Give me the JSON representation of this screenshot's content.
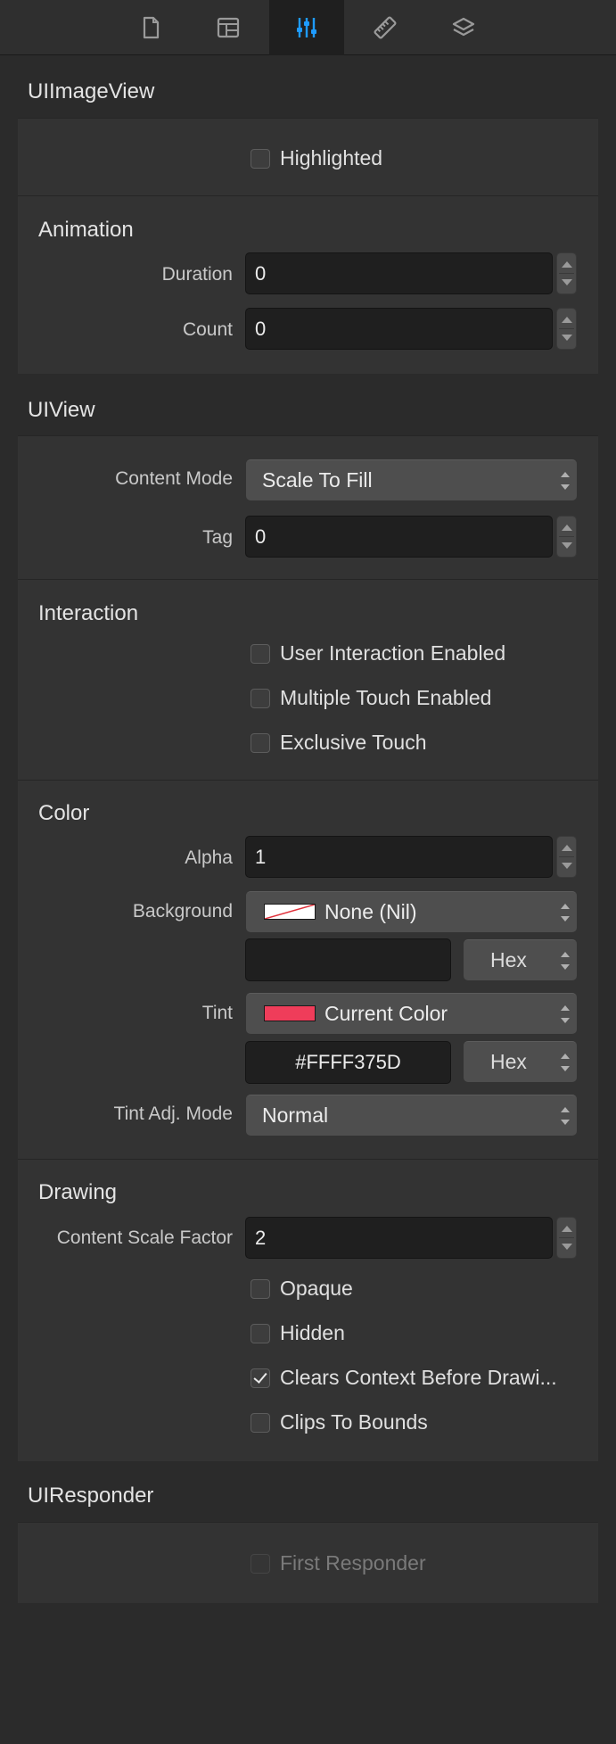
{
  "tabs": [
    {
      "icon": "file-icon"
    },
    {
      "icon": "layout-icon"
    },
    {
      "icon": "sliders-icon",
      "active": true
    },
    {
      "icon": "ruler-icon"
    },
    {
      "icon": "layers-icon"
    }
  ],
  "uiimageview": {
    "title": "UIImageView",
    "highlighted": "Highlighted",
    "animation": {
      "title": "Animation",
      "duration_label": "Duration",
      "duration_value": "0",
      "count_label": "Count",
      "count_value": "0"
    }
  },
  "uiview": {
    "title": "UIView",
    "content_mode_label": "Content Mode",
    "content_mode_value": "Scale To Fill",
    "tag_label": "Tag",
    "tag_value": "0",
    "interaction": {
      "title": "Interaction",
      "user_interaction": "User Interaction Enabled",
      "multiple_touch": "Multiple Touch Enabled",
      "exclusive_touch": "Exclusive Touch"
    },
    "color": {
      "title": "Color",
      "alpha_label": "Alpha",
      "alpha_value": "1",
      "background_label": "Background",
      "background_value": "None (Nil)",
      "background_hex": "",
      "hex_label": "Hex",
      "tint_label": "Tint",
      "tint_value": "Current Color",
      "tint_hex": "#FFFF375D",
      "tint_color": "#ef3d5a",
      "tint_adj_label": "Tint Adj. Mode",
      "tint_adj_value": "Normal"
    },
    "drawing": {
      "title": "Drawing",
      "scale_label": "Content Scale Factor",
      "scale_value": "2",
      "opaque": "Opaque",
      "hidden": "Hidden",
      "clears_context": "Clears Context Before Drawi...",
      "clips_to_bounds": "Clips To Bounds"
    }
  },
  "uiresponder": {
    "title": "UIResponder",
    "first_responder": "First Responder"
  }
}
